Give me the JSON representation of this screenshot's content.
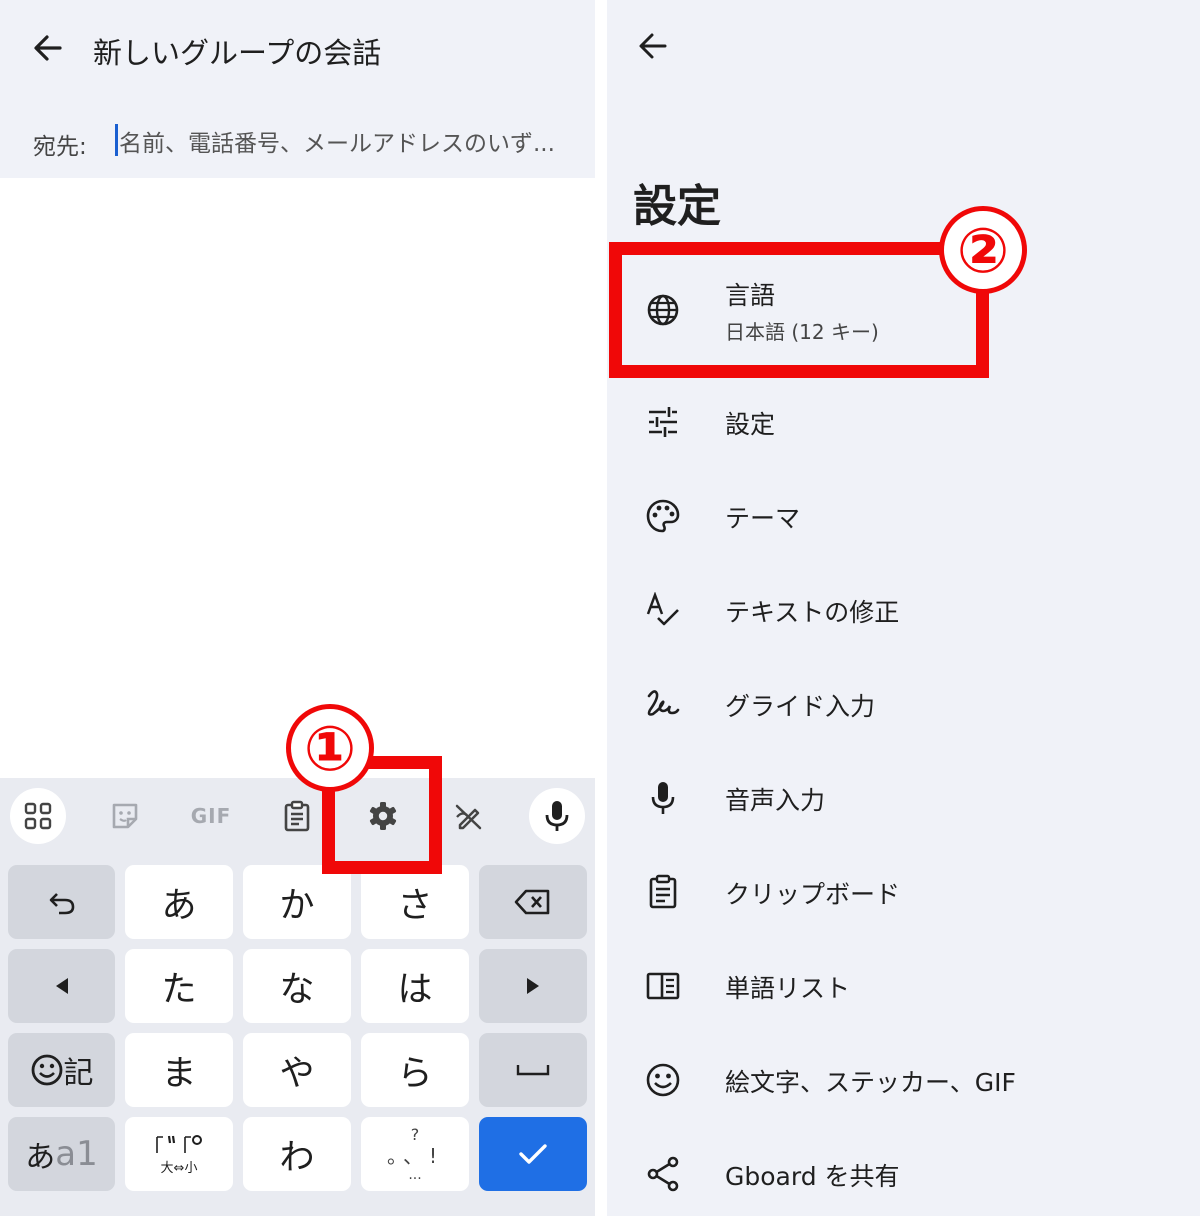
{
  "left": {
    "title": "新しいグループの会話",
    "to_label": "宛先:",
    "to_placeholder": "名前、電話番号、メールアドレスのいず...",
    "toolbar": {
      "gif_label": "GIF"
    },
    "keys": {
      "row1": [
        "あ",
        "か",
        "さ"
      ],
      "row2": [
        "た",
        "な",
        "は"
      ],
      "row3": [
        "ま",
        "や",
        "ら"
      ],
      "row4_mid": "わ",
      "emoji_key_label": "記",
      "mode_key_a": "あ",
      "mode_key_b": "a1",
      "dakuten_key_bottom": "大⇔小",
      "punct_key_top": "?",
      "punct_key_mid": "。、!",
      "punct_key_bottom": "..."
    }
  },
  "right": {
    "title": "設定",
    "items": [
      {
        "label": "言語",
        "sub": "日本語 (12 キー)",
        "icon": "globe-icon"
      },
      {
        "label": "設定",
        "icon": "tune-icon"
      },
      {
        "label": "テーマ",
        "icon": "palette-icon"
      },
      {
        "label": "テキストの修正",
        "icon": "spellcheck-icon"
      },
      {
        "label": "グライド入力",
        "icon": "gesture-icon"
      },
      {
        "label": "音声入力",
        "icon": "mic-icon"
      },
      {
        "label": "クリップボード",
        "icon": "clipboard-icon"
      },
      {
        "label": "単語リスト",
        "icon": "dictionary-icon"
      },
      {
        "label": "絵文字、ステッカー、GIF",
        "icon": "emoji-icon"
      },
      {
        "label": "Gboard を共有",
        "icon": "share-icon"
      }
    ]
  },
  "annotations": {
    "badge1": "①",
    "badge2": "②",
    "color": "#f00808"
  }
}
